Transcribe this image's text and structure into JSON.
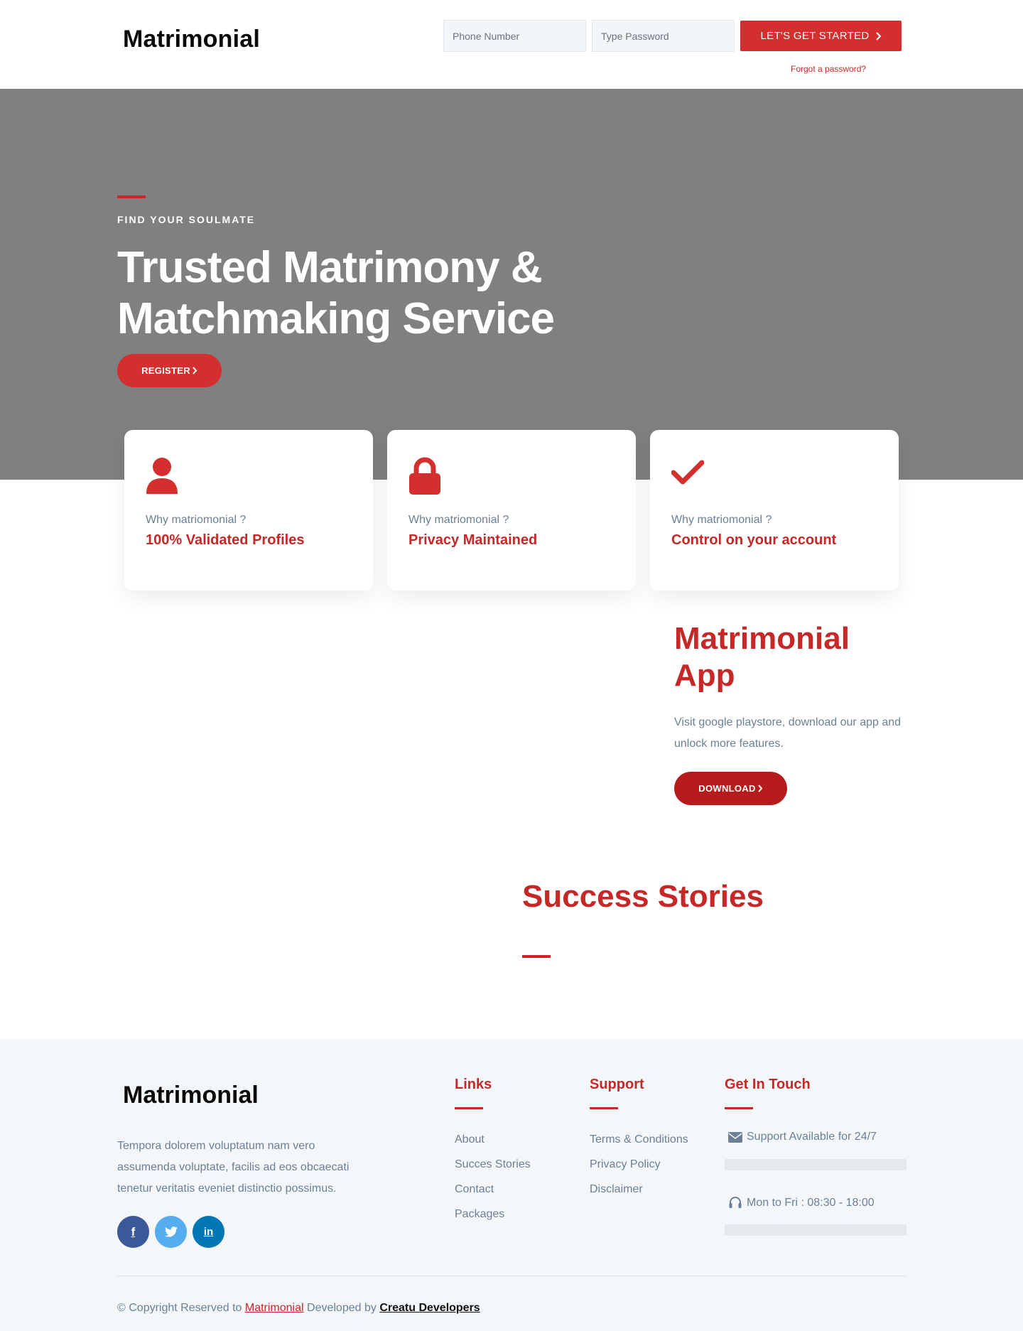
{
  "header": {
    "logo": "Matrimonial",
    "phone_placeholder": "Phone Number",
    "password_placeholder": "Type Password",
    "cta_label": "LET'S GET STARTED",
    "forgot_label": "Forgot a password?"
  },
  "hero": {
    "eyebrow": "FIND YOUR SOULMATE",
    "title_line1": "Trusted Matrimony &",
    "title_line2": "Matchmaking Service",
    "register_label": "REGISTER"
  },
  "features": [
    {
      "icon": "user-icon",
      "subtitle": "Why matriomonial ?",
      "title": "100% Validated Profiles"
    },
    {
      "icon": "lock-icon",
      "subtitle": "Why matriomonial ?",
      "title": "Privacy Maintained"
    },
    {
      "icon": "check-icon",
      "subtitle": "Why matriomonial ?",
      "title": "Control on your account"
    }
  ],
  "app_section": {
    "title_line1": "Matrimonial",
    "title_line2": "App",
    "description": "Visit google playstore, download our app and unlock more features.",
    "download_label": "DOWNLOAD"
  },
  "stories": {
    "title": "Success Stories"
  },
  "footer": {
    "logo": "Matrimonial",
    "about": "Tempora dolorem voluptatum nam vero assumenda voluptate, facilis ad eos obcaecati tenetur veritatis eveniet distinctio possimus.",
    "social": [
      {
        "icon": "facebook-icon",
        "glyph": "f",
        "color": "#3b5998"
      },
      {
        "icon": "twitter-icon",
        "glyph": "",
        "color": "#55acee"
      },
      {
        "icon": "linkedin-icon",
        "glyph": "in",
        "color": "#0077b5"
      }
    ],
    "links_heading": "Links",
    "links": [
      "About",
      "Succes Stories",
      "Contact",
      "Packages"
    ],
    "support_heading": "Support",
    "support_links": [
      "Terms & Conditions",
      "Privacy Policy",
      "Disclaimer"
    ],
    "touch_heading": "Get In Touch",
    "touch_items": [
      {
        "icon": "envelope-icon",
        "text": "Support Available for 24/7"
      },
      {
        "icon": "headset-icon",
        "text": "Mon to Fri : 08:30 - 18:00"
      }
    ],
    "copyright_prefix": "© Copyright Reserved to",
    "copyright_brand": "Matrimonial",
    "copyright_mid": "Developed by",
    "copyright_dev": "Creatu Developers"
  },
  "colors": {
    "accent": "#d32f2f",
    "accent_dark": "#b71c1c",
    "hero_bg": "#808080",
    "footer_bg": "#f4f7f9",
    "muted_text": "#6b7f96"
  }
}
